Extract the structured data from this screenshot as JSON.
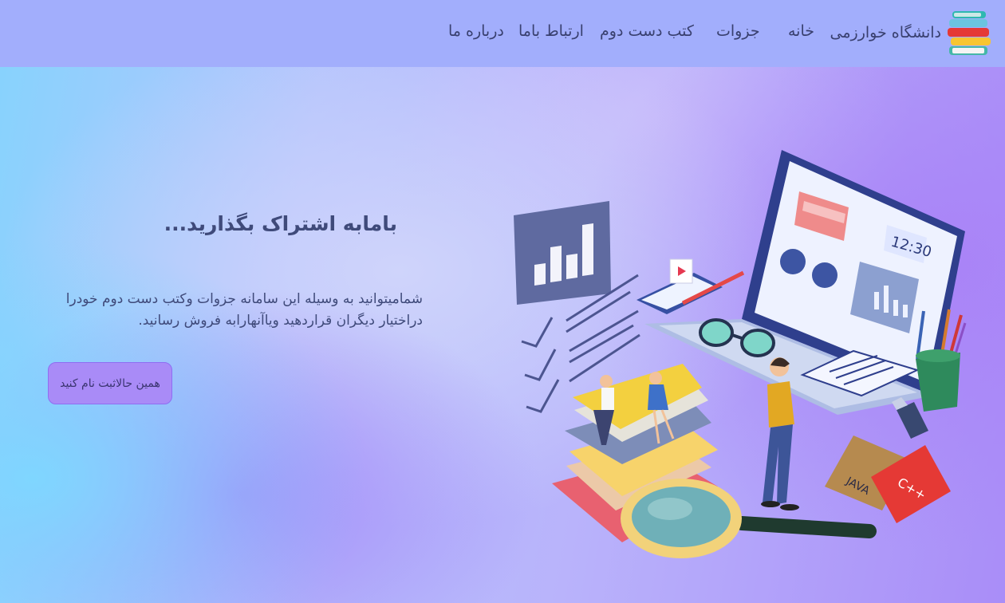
{
  "nav": {
    "brand": "دانشگاه خوارزمی",
    "items": [
      {
        "label": "خانه"
      },
      {
        "label": "جزوات"
      },
      {
        "label": "کتب دست دوم"
      },
      {
        "label": "ارتباط باما"
      },
      {
        "label": "درباره ما"
      }
    ]
  },
  "hero": {
    "title": "بامابه اشتراک بگذارید...",
    "description_line1": "شمامیتوانید به وسیله این سامانه جزوات وکتب دست دوم خودرا",
    "description_line2": "دراختیار دیگران قراردهید ویاآنهارابه فروش رسانید.",
    "cta_label": "همین حالاثبت نام کنید"
  },
  "illustration": {
    "laptop_clock": "12:30",
    "book_java": "JAVA",
    "book_cpp": "C++"
  },
  "colors": {
    "navbar": "#a2aefc",
    "nav_text": "#39406f",
    "cta_bg": "#a98bf7",
    "accent_cyan": "#86d3fd",
    "accent_purple": "#a98df8"
  }
}
